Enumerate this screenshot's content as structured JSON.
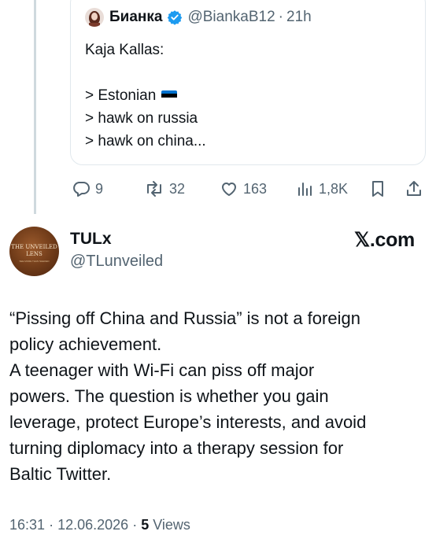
{
  "quoted_tweet": {
    "author_name": "Бианка",
    "handle": "@BiankaB12",
    "separator": "·",
    "time": "21h",
    "lines": [
      "Kaja Kallas:",
      "",
      "> Estonian",
      "> hawk on russia",
      "> hawk on china..."
    ]
  },
  "actions": {
    "replies": "9",
    "reposts": "32",
    "likes": "163",
    "views": "1,8K"
  },
  "post": {
    "author_name": "TULx",
    "handle": "@TLunveiled",
    "avatar_text": [
      "THE UNVEILED",
      "LENS",
      "SEE MORE THAN NEEDED"
    ],
    "source_label": "𝕏.com",
    "lines": [
      "“Pissing off China and Russia” is not a foreign",
      "policy achievement.",
      "A teenager with Wi-Fi can piss off major",
      "powers. The question is whether you gain",
      "leverage, protect Europe’s interests, and avoid",
      "turning diplomacy into a therapy session for",
      "Baltic Twitter."
    ]
  },
  "meta": {
    "time": "16:31",
    "separator": "·",
    "date": "12.06.2026",
    "separator2": "·",
    "views_count": "5",
    "views_label": "Views"
  },
  "colors": {
    "text": "#0f1419",
    "secondary": "#536471",
    "verified": "#1d9bf0",
    "thread_line": "#cfd9de",
    "flag": [
      "#0072ce",
      "#000000",
      "#ffffff"
    ]
  }
}
